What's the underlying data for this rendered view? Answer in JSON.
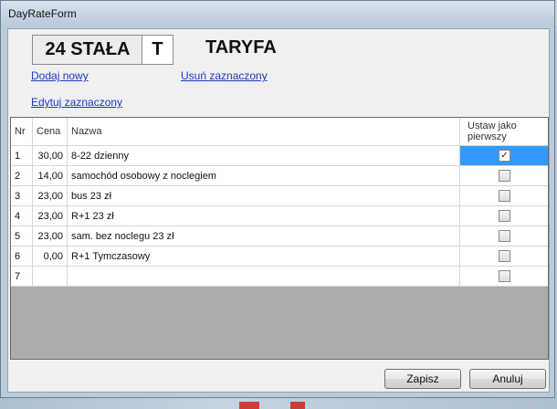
{
  "window": {
    "title": "DayRateForm"
  },
  "header": {
    "code": "24 STAŁA",
    "type_letter": "T",
    "tariff_title": "TARYFA"
  },
  "links": {
    "add_new": "Dodaj nowy",
    "delete_selected": "Usuń zaznaczony",
    "edit_selected": "Edytuj zaznaczony"
  },
  "grid": {
    "columns": [
      "Nr",
      "Cena",
      "Nazwa",
      "Ustaw jako pierwszy"
    ],
    "rows": [
      {
        "nr": "1",
        "cena": "30,00",
        "nazwa": "8-22 dzienny",
        "first": true
      },
      {
        "nr": "2",
        "cena": "14,00",
        "nazwa": "samochód osobowy z noclegiem",
        "first": false
      },
      {
        "nr": "3",
        "cena": "23,00",
        "nazwa": "bus  23 zł",
        "first": false
      },
      {
        "nr": "4",
        "cena": "23,00",
        "nazwa": "R+1 23 zł",
        "first": false
      },
      {
        "nr": "5",
        "cena": "23,00",
        "nazwa": "sam. bez noclegu  23 zł",
        "first": false
      },
      {
        "nr": "6",
        "cena": "0,00",
        "nazwa": "R+1  Tymczasowy",
        "first": false
      },
      {
        "nr": "7",
        "cena": "",
        "nazwa": "",
        "first": false
      }
    ],
    "selected_row": 1
  },
  "buttons": {
    "save": "Zapisz",
    "cancel": "Anuluj"
  },
  "colors": {
    "selection": "#3399ff",
    "link": "#1c37c6",
    "grid_empty": "#ababab"
  }
}
